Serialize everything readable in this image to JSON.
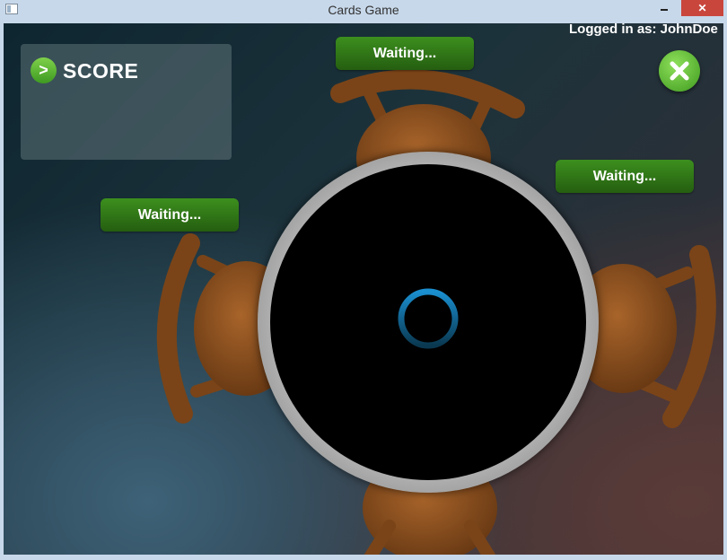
{
  "window": {
    "title": "Cards Game",
    "controls": {
      "minimize": "",
      "maximize": "",
      "close": "✕"
    }
  },
  "score_panel": {
    "arrow_glyph": ">",
    "label": "SCORE"
  },
  "login": {
    "text": "Logged in as: JohnDoe"
  },
  "exit_button": {
    "icon": "close-x-icon"
  },
  "seats": [
    {
      "position": "top",
      "status": "Waiting..."
    },
    {
      "position": "right",
      "status": "Waiting..."
    },
    {
      "position": "left",
      "status": "Waiting..."
    },
    {
      "position": "bottom",
      "status": ""
    }
  ],
  "table": {
    "state": "loading",
    "spinner_icon": "loading-spinner-icon"
  },
  "colors": {
    "accent_green": "#3c8f1e",
    "chair_brown": "#8a4f1f",
    "spinner_blue": "#1a8fd0",
    "titlebar": "#c7d8ea",
    "close_red": "#c9463d"
  }
}
